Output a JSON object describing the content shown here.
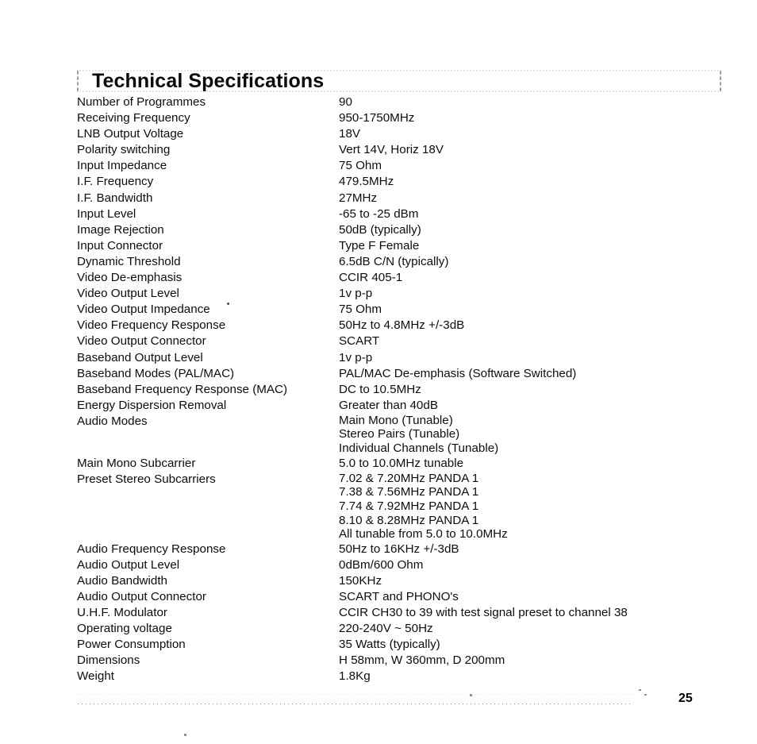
{
  "page": {
    "title": "Technical Specifications",
    "number": "25"
  },
  "specs": [
    {
      "label": "Number of Programmes",
      "value": "90"
    },
    {
      "label": "Receiving Frequency",
      "value": "950-1750MHz"
    },
    {
      "label": "LNB Output Voltage",
      "value": "18V"
    },
    {
      "label": "Polarity switching",
      "value": "Vert 14V, Horiz 18V"
    },
    {
      "label": "Input Impedance",
      "value": "75 Ohm"
    },
    {
      "label": "I.F. Frequency",
      "value": "479.5MHz"
    },
    {
      "label": "I.F. Bandwidth",
      "value": "27MHz"
    },
    {
      "label": "Input Level",
      "value": "-65 to -25 dBm"
    },
    {
      "label": "Image Rejection",
      "value": "50dB (typically)"
    },
    {
      "label": "Input Connector",
      "value": "Type F Female"
    },
    {
      "label": "Dynamic Threshold",
      "value": "6.5dB C/N (typically)"
    },
    {
      "label": "Video De-emphasis",
      "value": "CCIR 405-1"
    },
    {
      "label": "Video Output Level",
      "value": "1v p-p"
    },
    {
      "label": "Video Output Impedance",
      "value": "75 Ohm"
    },
    {
      "label": "Video Frequency Response",
      "value": "50Hz to 4.8MHz +/-3dB"
    },
    {
      "label": "Video Output Connector",
      "value": "SCART"
    },
    {
      "label": "Baseband Output Level",
      "value": "1v p-p"
    },
    {
      "label": "Baseband Modes (PAL/MAC)",
      "value": "PAL/MAC De-emphasis (Software Switched)"
    },
    {
      "label": "Baseband Frequency Response (MAC)",
      "value": "DC to 10.5MHz"
    },
    {
      "label": "Energy Dispersion Removal",
      "value": "Greater than 40dB"
    },
    {
      "label": "Audio Modes",
      "value": "Main Mono (Tunable)\nStereo Pairs (Tunable)\nIndividual Channels (Tunable)",
      "multiline": true
    },
    {
      "label": "Main Mono Subcarrier",
      "value": "5.0 to 10.0MHz tunable"
    },
    {
      "label": "Preset Stereo Subcarriers",
      "value": "7.02 & 7.20MHz PANDA 1\n7.38 & 7.56MHz PANDA 1\n7.74 & 7.92MHz PANDA 1\n8.10 & 8.28MHz PANDA 1\nAll tunable from 5.0 to 10.0MHz",
      "multiline": true
    },
    {
      "label": "Audio Frequency Response",
      "value": "50Hz to 16KHz +/-3dB"
    },
    {
      "label": "Audio Output Level",
      "value": "0dBm/600 Ohm"
    },
    {
      "label": "Audio Bandwidth",
      "value": "150KHz"
    },
    {
      "label": "Audio Output Connector",
      "value": "SCART and PHONO's"
    },
    {
      "label": "U.H.F. Modulator",
      "value": "CCIR CH30 to 39 with test signal preset to channel 38"
    },
    {
      "label": "Operating voltage",
      "value": "220-240V ~ 50Hz"
    },
    {
      "label": "Power Consumption",
      "value": "35 Watts (typically)"
    },
    {
      "label": "Dimensions",
      "value": "H 58mm, W 360mm, D 200mm"
    },
    {
      "label": "Weight",
      "value": "1.8Kg"
    }
  ]
}
